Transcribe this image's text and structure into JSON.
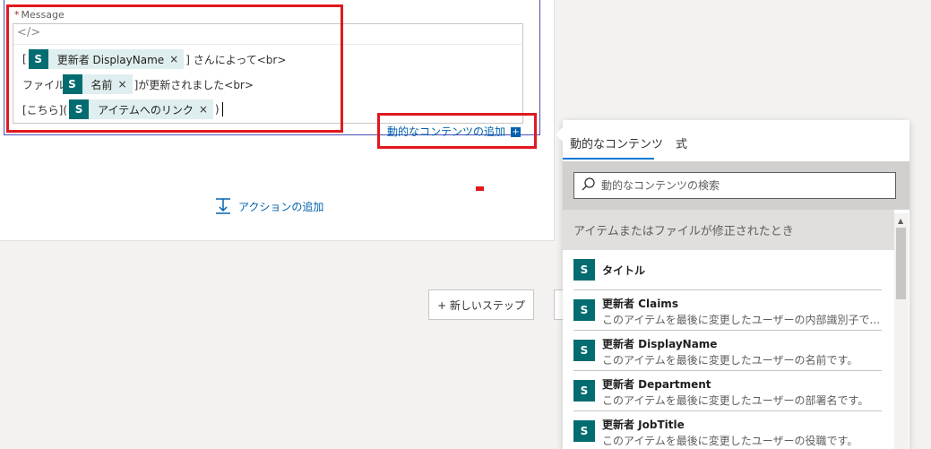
{
  "editor": {
    "label": "Message",
    "required_mark": "*",
    "code_icon": "</>",
    "line1": {
      "prefix": "[",
      "token": "更新者 DisplayName",
      "suffix": "] さんによって<br>"
    },
    "line2": {
      "prefix": "ファイル [",
      "token": "名前",
      "suffix": "]が更新されました<br>"
    },
    "line3": {
      "prefix": "[こちら](",
      "token": "アイテムへのリンク",
      "suffix": ")"
    },
    "token_close": "×",
    "sp_glyph": "S"
  },
  "add_dynamic": {
    "label": "動的なコンテンツの追加",
    "plus": "+"
  },
  "add_action": {
    "label": "アクションの追加"
  },
  "new_step": {
    "label": "+ 新しいステップ"
  },
  "panel": {
    "tabs": [
      {
        "label": "動的なコンテンツ",
        "active": true
      },
      {
        "label": "式",
        "active": false
      }
    ],
    "search": {
      "placeholder": "動的なコンテンツの検索"
    },
    "section_title": "アイテムまたはファイルが修正されたとき",
    "items": [
      {
        "title": "タイトル",
        "desc": ""
      },
      {
        "title": "更新者 Claims",
        "desc": "このアイテムを最後に変更したユーザーの内部識別子で..."
      },
      {
        "title": "更新者 DisplayName",
        "desc": "このアイテムを最後に変更したユーザーの名前です。"
      },
      {
        "title": "更新者 Department",
        "desc": "このアイテムを最後に変更したユーザーの部署名です。"
      },
      {
        "title": "更新者 JobTitle",
        "desc": "このアイテムを最後に変更したユーザーの役職です。"
      }
    ]
  },
  "colors": {
    "highlight_red": "#e0191f",
    "link_blue": "#0062ad",
    "sharepoint_teal": "#036c70",
    "token_bg": "#dfeeee",
    "active_tab_underline": "#0078d4"
  }
}
